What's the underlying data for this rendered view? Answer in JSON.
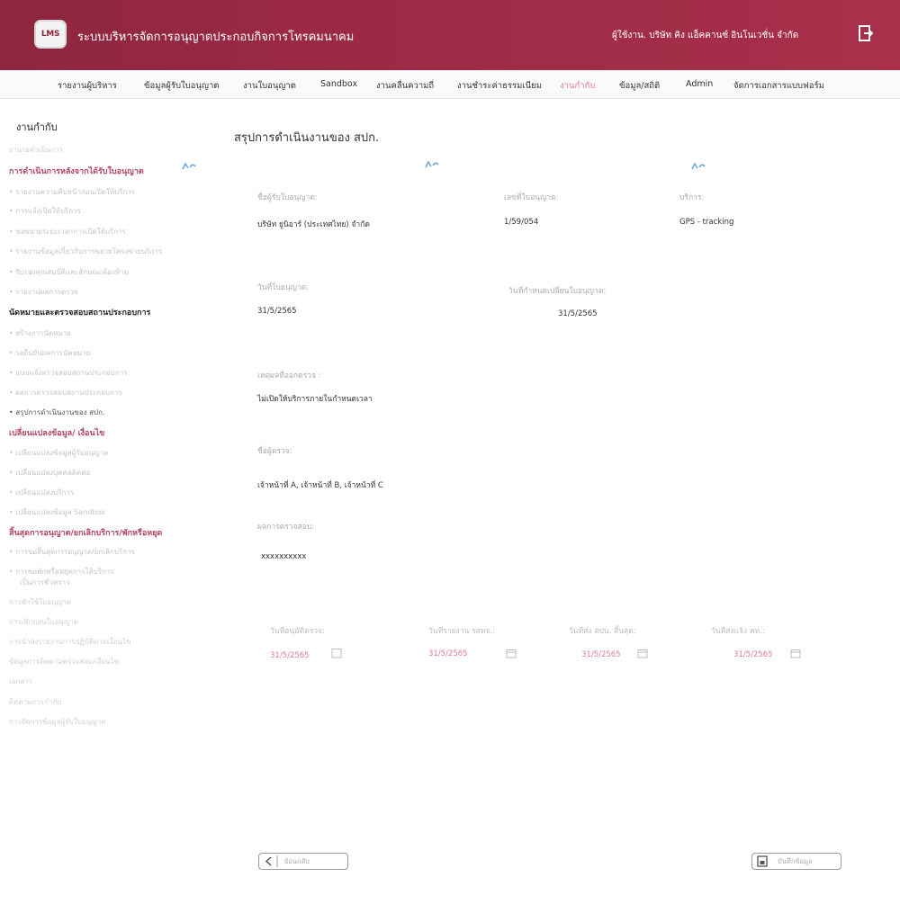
{
  "header": {
    "logo_text": "LMS",
    "title": "ระบบบริหารจัดการอนุญาตประกอบกิจการโทรคมนาคม",
    "user": "ผู้ใช้งาน. บริษัท คิง แอ็คคานซ์ อินโนเวชั่น จำกัด",
    "logout_icon": "logout-icon"
  },
  "nav": [
    {
      "label": "รายงานผู้บริหาร",
      "active": false
    },
    {
      "label": "ข้อมูลผู้รับใบอนุญาต",
      "active": false
    },
    {
      "label": "งานใบอนุญาต",
      "active": false
    },
    {
      "label": "Sandbox",
      "active": false
    },
    {
      "label": "งานคลื่นความถี่",
      "active": false
    },
    {
      "label": "งานชำระค่าธรรมเนียม",
      "active": false
    },
    {
      "label": "งานกำกับ",
      "active": true
    },
    {
      "label": "ข้อมูล/สถิติ",
      "active": false
    },
    {
      "label": "Admin",
      "active": false
    },
    {
      "label": "จัดการเอกสารแบบฟอร์ม",
      "active": false
    }
  ],
  "sidebar": {
    "title": "งานกำกับ",
    "items": [
      "งานรอดำเนินการ",
      "การดำเนินการหลังจากได้รับใบอนุญาต",
      "• รายงานความคืบหน้าก่อนเปิดให้บริการ",
      "• การแจ้งเปิดให้บริการ",
      "• ขอขยายระยะเวลาการเปิดให้บริการ",
      "• รายงานข้อมูลเกี่ยวกับการขยายโครงข่ายบริการ",
      "• รับรองคุณสมบัติและลักษณะต้องห้าม",
      "• รายงานผลการตรวจ",
      "นัดหมายและตรวจสอบสถานประกอบการ",
      "• สร้างการนัดหมาย",
      "• รอยืนยันผลการนัดหมาย",
      "• แบบแจ้งตรวจสอบสถานประกอบการ",
      "• ผลการตรวจสอบสถานประกอบการ",
      "• สรุปการดำเนินงานของ สปก.",
      "เปลี่ยนแปลงข้อมูล/ เงื่อนไข",
      "• เปลี่ยนแปลงข้อมูลผู้รับอนุญาต",
      "• เปลี่ยนแปลงบุคคลติดต่อ",
      "• เปลี่ยนแปลงบริการ",
      "• เปลี่ยนแปลงข้อมูล Sandbox",
      "สิ้นสุดการอนุญาต/ยกเลิกบริการ/พักหรือหยุด",
      "• การขอสิ้นสุดการอนุญาต/ยกเลิกบริการ",
      "• การขอพักหรือหยุดการให้บริการ",
      "เป็นการชั่วคราว",
      "การพักใช้ใบอนุญาต",
      "การเพิกถอนใบอนุญาต",
      "การนำส่งรายงานการปฏิบัติตามเงื่อนไข",
      "ข้อมูลการติดตามตรวจสอบ/เงื่อนไข",
      "เอกสาร",
      "ติดตามการกำกับ",
      "การจัดการข้อมูลผู้รับใบอนุญาต"
    ]
  },
  "main": {
    "title": "สรุปการดำเนินงานของ สปก.",
    "licensee_label": "ชื่อผู้รับใบอนุญาต:",
    "licensee_value": "บริษัท ยูนิอาร์ (ประเทศไทย) จำกัด",
    "license_no_label": "เลขที่ใบอนุญาต:",
    "license_no_value": "1/59/054",
    "service_label": "บริการ:",
    "service_value": "GPS - tracking",
    "license_date_label": "วันที่ใบอนุญาต:",
    "license_date_value": "31/5/2565",
    "expire_label": "วันที่กำหนดเปลี่ยนใบอนุญาต:",
    "expire_value": "31/5/2565",
    "reason_label": "เหตุผลที่ออกตรวจ :",
    "reason_value": "ไม่เปิดให้บริการภายในกำหนดเวลา",
    "inspector_label": "ชื่อผู้ตรวจ:",
    "inspector_value": "เจ้าหน้าที่ A, เจ้าหน้าที่ B, เจ้าหน้าที่ C",
    "result_label": "ผลการตรวจสอบ:",
    "result_value": "xxxxxxxxxx",
    "dates": [
      {
        "label": "วันที่อนุมัติตรวจ:",
        "value": "31/5/2565"
      },
      {
        "label": "วันที่รายงาน รสทจ.:",
        "value": "31/5/2565"
      },
      {
        "label": "วันที่ส่ง สปน. สิ้นสุด:",
        "value": "31/5/2565"
      },
      {
        "label": "วันที่ส่งแจ้ง คท.:",
        "value": "31/5/2565"
      }
    ],
    "back_label": "ย้อนกลับ",
    "save_label": "บันทึกข้อมูล"
  },
  "colors": {
    "header": "#9c2a45",
    "active_nav": "#e07b96",
    "date_value": "#e07b96",
    "section_pink": "#b2455f"
  }
}
